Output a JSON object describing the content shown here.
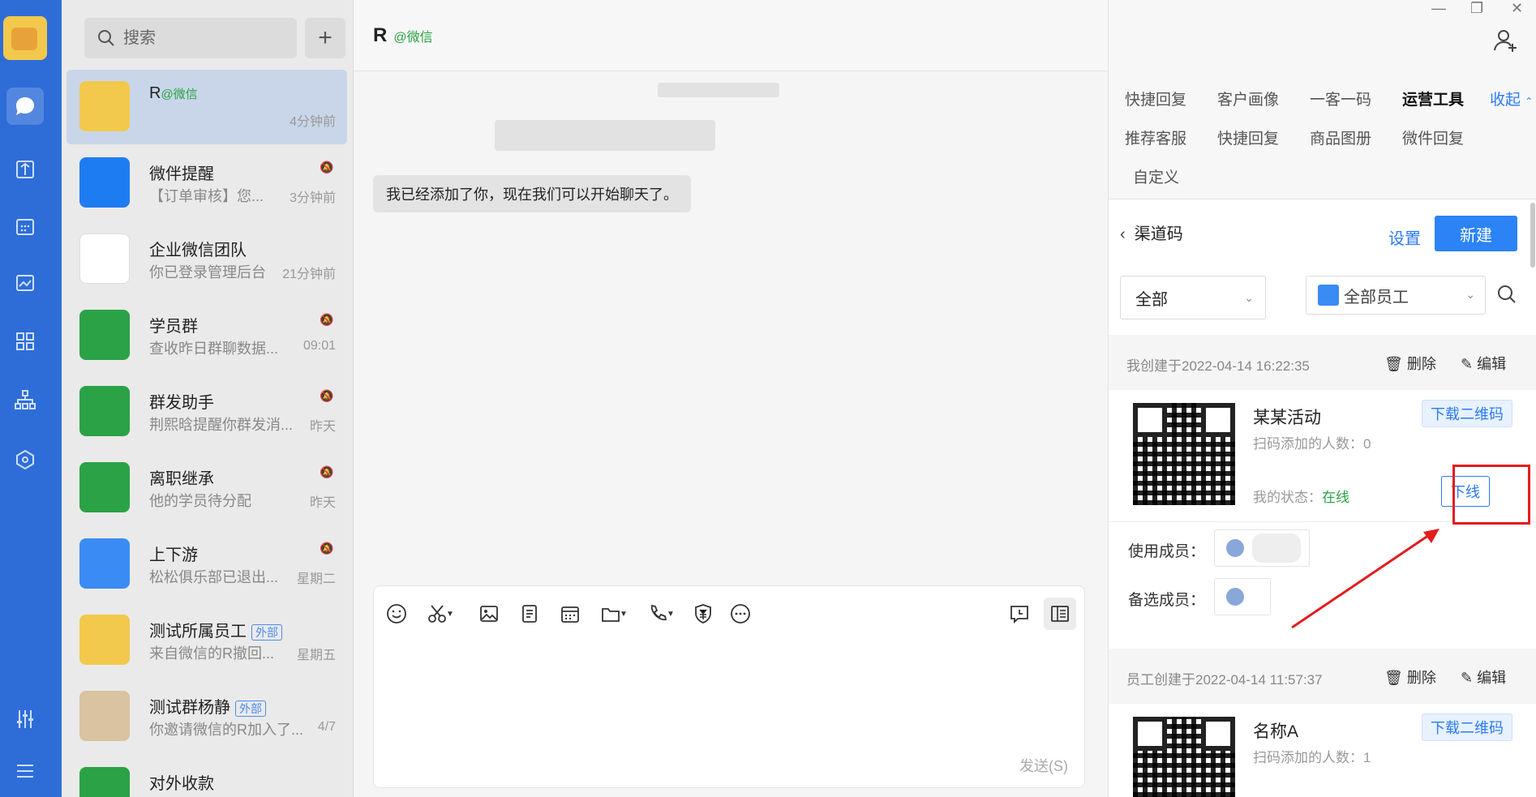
{
  "rail": {
    "items": [
      "chat-icon",
      "docs-icon",
      "calendar-icon",
      "workbench-icon",
      "apps-icon",
      "org-icon",
      "cube-icon",
      "settings-icon",
      "menu-icon"
    ]
  },
  "search": {
    "placeholder": "搜索"
  },
  "conversations": [
    {
      "name": "R",
      "tag": "@微信",
      "sub": "",
      "time": "4分钟前",
      "color": "#f2c94c",
      "muted": false
    },
    {
      "name": "微伴提醒",
      "tag": "",
      "sub": "【订单审核】您...",
      "time": "3分钟前",
      "color": "#1e7cf2",
      "muted": true
    },
    {
      "name": "企业微信团队",
      "tag": "",
      "sub": "你已登录管理后台",
      "time": "21分钟前",
      "color": "#ffffff",
      "muted": false
    },
    {
      "name": "学员群",
      "tag": "",
      "sub": "查收昨日群聊数据...",
      "time": "09:01",
      "color": "#2ba245",
      "muted": true
    },
    {
      "name": "群发助手",
      "tag": "",
      "sub": "荆熙晗提醒你群发消...",
      "time": "昨天",
      "color": "#2ba245",
      "muted": true
    },
    {
      "name": "离职继承",
      "tag": "",
      "sub": "他的学员待分配",
      "time": "昨天",
      "color": "#2ba245",
      "muted": true
    },
    {
      "name": "上下游",
      "tag": "",
      "sub": "松松俱乐部已退出...",
      "time": "星期二",
      "color": "#3a8bf4",
      "muted": true
    },
    {
      "name": "测试所属员工",
      "ext": "外部",
      "sub": "来自微信的R撤回...",
      "time": "星期五",
      "color": "#f2c94c",
      "muted": false
    },
    {
      "name": "测试群杨静",
      "ext": "外部",
      "sub": "你邀请微信的R加入了...",
      "time": "4/7",
      "color": "#d9c3a0",
      "muted": false
    },
    {
      "name": "对外收款",
      "tag": "",
      "sub": "",
      "time": "",
      "color": "#2ba245",
      "muted": false
    }
  ],
  "chat": {
    "title": "R",
    "title_tag": "@微信",
    "message": "我已经添加了你，现在我们可以开始聊天了。",
    "send_label": "发送(S)"
  },
  "panel": {
    "tabs_row1": [
      "快捷回复",
      "客户画像",
      "一客一码",
      "运营工具"
    ],
    "collapse": "收起",
    "tabs_row2": [
      "推荐客服",
      "快捷回复",
      "商品图册",
      "微件回复"
    ],
    "tabs_row3": [
      "自定义"
    ],
    "section_title": "渠道码",
    "settings_link": "设置",
    "new_button": "新建",
    "filter_all": "全部",
    "filter_staff": "全部员工",
    "cards": [
      {
        "meta": "我创建于2022-04-14 16:22:35",
        "delete": "删除",
        "edit": "编辑",
        "name": "某某活动",
        "count_label": "扫码添加的人数：0",
        "state_label": "我的状态：",
        "state_value": "在线",
        "download": "下载二维码",
        "offline": "下线",
        "members_label": "使用成员：",
        "backup_label": "备选成员："
      },
      {
        "meta": "员工创建于2022-04-14 11:57:37",
        "delete": "删除",
        "edit": "编辑",
        "name": "名称A",
        "count_label": "扫码添加的人数：1",
        "download": "下载二维码"
      }
    ]
  }
}
